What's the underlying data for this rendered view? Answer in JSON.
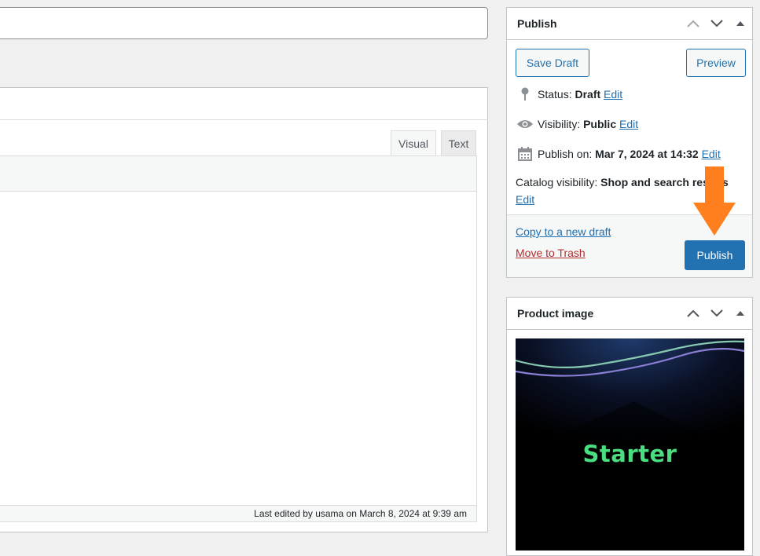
{
  "editor": {
    "tabs": {
      "visual": "Visual",
      "text": "Text"
    },
    "last_edited": "Last edited by usama on March 8, 2024 at 9:39 am"
  },
  "publish": {
    "title": "Publish",
    "save_draft": "Save Draft",
    "preview": "Preview",
    "status_label": "Status:",
    "status_value": "Draft",
    "visibility_label": "Visibility:",
    "visibility_value": "Public",
    "publish_on_label": "Publish on:",
    "publish_on_value": "Mar 7, 2024 at 14:32",
    "catalog_label": "Catalog visibility:",
    "catalog_value": "Shop and search results",
    "edit": "Edit",
    "copy_draft": "Copy to a new draft",
    "trash": "Move to Trash",
    "publish_button": "Publish"
  },
  "product_image": {
    "title": "Product image",
    "image_text": "Starter"
  },
  "colors": {
    "primary": "#2271b1",
    "trash": "#b32d2e",
    "arrow": "#ff7f1f",
    "starter_text": "#4ade80"
  },
  "icons": [
    "pin-icon",
    "eye-icon",
    "calendar-icon",
    "chevron-up-icon",
    "chevron-down-icon",
    "triangle-up-icon",
    "arrow-down-icon"
  ]
}
